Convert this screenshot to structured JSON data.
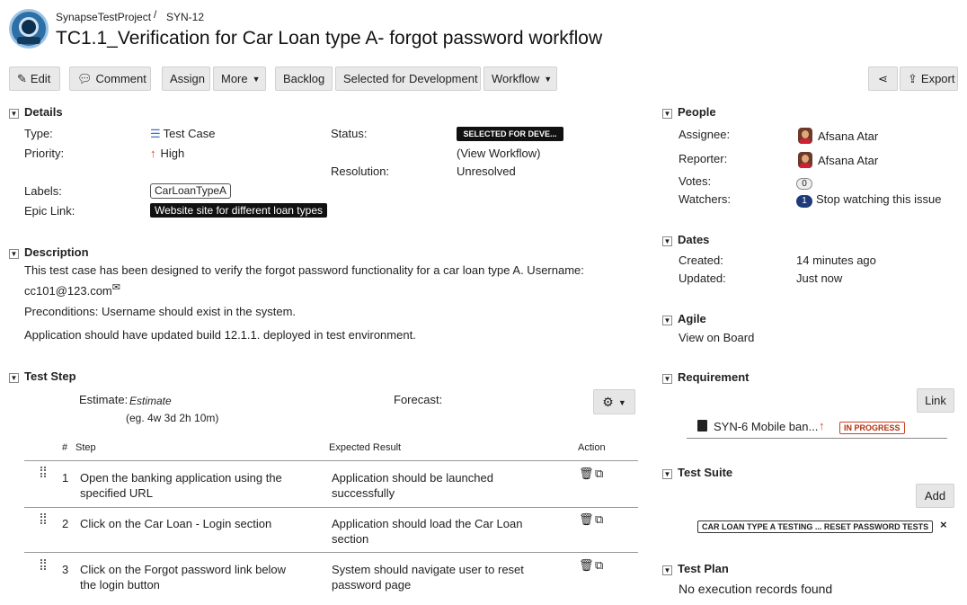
{
  "header": {
    "project": "SynapseTestProject",
    "separator": "/",
    "issue_key": "SYN-12",
    "title": "TC1.1_Verification for Car Loan type A- forgot password workflow"
  },
  "toolbar": {
    "edit": "Edit",
    "comment": "Comment",
    "assign": "Assign",
    "more": "More",
    "backlog": "Backlog",
    "selected_for_development": "Selected for Development",
    "workflow": "Workflow",
    "export": "Export"
  },
  "details": {
    "heading": "Details",
    "type_label": "Type:",
    "type_value": "Test Case",
    "priority_label": "Priority:",
    "priority_value": "High",
    "status_label": "Status:",
    "status_value": "SELECTED FOR DEVE...",
    "view_workflow": "(View Workflow)",
    "resolution_label": "Resolution:",
    "resolution_value": "Unresolved",
    "labels_label": "Labels:",
    "labels_value": "CarLoanTypeA",
    "epic_label": "Epic Link:",
    "epic_value": "Website site for different loan types"
  },
  "description": {
    "heading": "Description",
    "line1": "This test case has been designed to verify the forgot password functionality for a car loan type A.  Username:",
    "line1b": "cc101@123.com",
    "line2": "Preconditions: Username should exist in the system.",
    "line3": "Application should have updated build 12.1.1. deployed in test environment."
  },
  "test_step": {
    "heading": "Test Step",
    "estimate_label": "Estimate:",
    "estimate_value": "Estimate",
    "estimate_hint": "(eg. 4w 3d 2h 10m)",
    "forecast_label": "Forecast:",
    "columns": {
      "num": "#",
      "step": "Step",
      "expected": "Expected Result",
      "action": "Action"
    },
    "rows": [
      {
        "num": "1",
        "step_a": "Open the banking application using the",
        "step_b": "specified URL",
        "exp_a": "Application should be launched",
        "exp_b": "successfully"
      },
      {
        "num": "2",
        "step_a": "Click on the Car Loan - Login section",
        "step_b": "",
        "exp_a": "Application should load the Car Loan",
        "exp_b": "section"
      },
      {
        "num": "3",
        "step_a": "Click on the Forgot password link below",
        "step_b": "the login button",
        "exp_a": "System should navigate user to reset",
        "exp_b": "password page"
      }
    ]
  },
  "people": {
    "heading": "People",
    "assignee_label": "Assignee:",
    "assignee_value": "Afsana Atar",
    "reporter_label": "Reporter:",
    "reporter_value": "Afsana Atar",
    "votes_label": "Votes:",
    "votes_count": "0",
    "watchers_label": "Watchers:",
    "watchers_count": "1",
    "watchers_action": "Stop watching this issue"
  },
  "dates": {
    "heading": "Dates",
    "created_label": "Created:",
    "created_value": "14 minutes ago",
    "updated_label": "Updated:",
    "updated_value": "Just now"
  },
  "agile": {
    "heading": "Agile",
    "link": "View on Board"
  },
  "requirement": {
    "heading": "Requirement",
    "link_button": "Link",
    "item": "SYN-6 Mobile ban...",
    "item_status": "IN PROGRESS"
  },
  "test_suite": {
    "heading": "Test Suite",
    "add_button": "Add",
    "tag": "CAR LOAN TYPE A TESTING ... RESET PASSWORD TESTS",
    "remove": "×"
  },
  "test_plan": {
    "heading": "Test Plan",
    "empty": "No execution records found"
  },
  "colors": {
    "status_bg": "#111111",
    "priority_arrow": "#e0401a",
    "type_icon": "#3b73c9"
  }
}
